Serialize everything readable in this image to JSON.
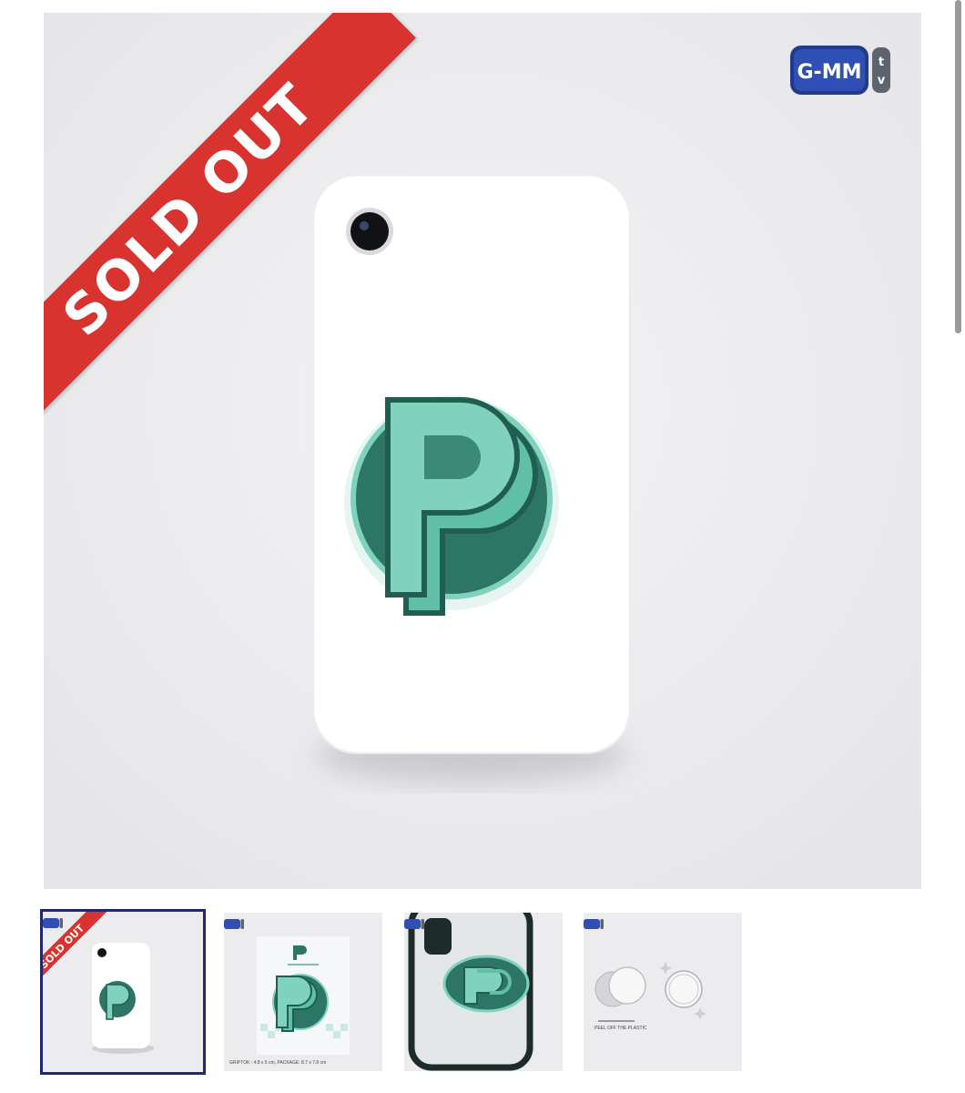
{
  "product": {
    "status_badge": "SOLD OUT",
    "brand_logo": {
      "text": "G-MM",
      "suffix": "tv"
    }
  },
  "thumbnails": [
    {
      "name": "phone-front-view",
      "badge": "SOLD OUT",
      "selected": true
    },
    {
      "name": "package-view",
      "caption": "GRIPTOK : 4.8 x 5 cm, PACKAGE: 8.7 x 7.8 cm"
    },
    {
      "name": "phone-case-view"
    },
    {
      "name": "instructions-view",
      "caption": "PEEL OFF THE PLASTIC"
    }
  ],
  "colors": {
    "ribbon": "#d8332f",
    "logo_blue": "#223a8c",
    "grip_dark": "#2d7564",
    "grip_light": "#7fd3bd",
    "selected_border": "#22286a"
  }
}
